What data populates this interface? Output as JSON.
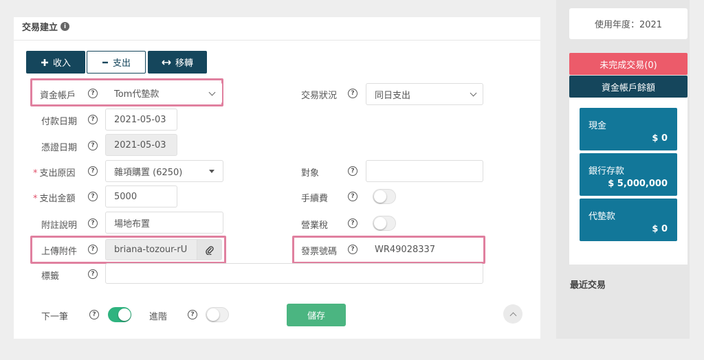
{
  "form": {
    "title": "交易建立",
    "tabs": [
      {
        "label": "收入",
        "icon": "plus-icon"
      },
      {
        "label": "支出",
        "icon": "minus-icon"
      },
      {
        "label": "移轉",
        "icon": "swap-arrows-icon"
      }
    ],
    "fields": {
      "account": {
        "label": "資金帳戶",
        "value": "Tom代墊款"
      },
      "pay_date": {
        "label": "付款日期",
        "value": "2021-05-03"
      },
      "voucher_date": {
        "label": "憑證日期",
        "value": "2021-05-03"
      },
      "reason": {
        "label": "支出原因",
        "value": "雜項購置 (6250)"
      },
      "amount": {
        "label": "支出金額",
        "value": "5000"
      },
      "note": {
        "label": "附註說明",
        "value": "場地布置"
      },
      "attachment": {
        "label": "上傳附件",
        "value": "briana-tozour-rU"
      },
      "tags": {
        "label": "標籤",
        "value": ""
      },
      "status": {
        "label": "交易狀況",
        "value": "同日支出"
      },
      "counterparty": {
        "label": "對象",
        "value": ""
      },
      "fee": {
        "label": "手續費",
        "on": false
      },
      "tax": {
        "label": "營業稅",
        "on": false
      },
      "invoice": {
        "label": "發票號碼",
        "value": "WR49028337"
      }
    },
    "next_toggle": {
      "label": "下一筆",
      "on": true
    },
    "advanced_toggle": {
      "label": "進階",
      "on": false
    },
    "save_label": "儲存",
    "required_mark": "*",
    "help_mark": "?",
    "info_mark": "i"
  },
  "sidebar": {
    "year": "使用年度：2021",
    "unfinished": "未完成交易(0)",
    "balance_title": "資金帳戶餘額",
    "accounts": [
      {
        "name": "現金",
        "amount": "$ 0"
      },
      {
        "name": "銀行存款",
        "amount": "$ 5,000,000"
      },
      {
        "name": "代墊款",
        "amount": "$ 0"
      }
    ],
    "recent": "最近交易"
  },
  "colors": {
    "primary_dark": "#15465c",
    "account_blue": "#127799",
    "danger_red": "#ec5b6a",
    "save_green": "#4bb581",
    "highlight_pink": "#e0809f"
  }
}
